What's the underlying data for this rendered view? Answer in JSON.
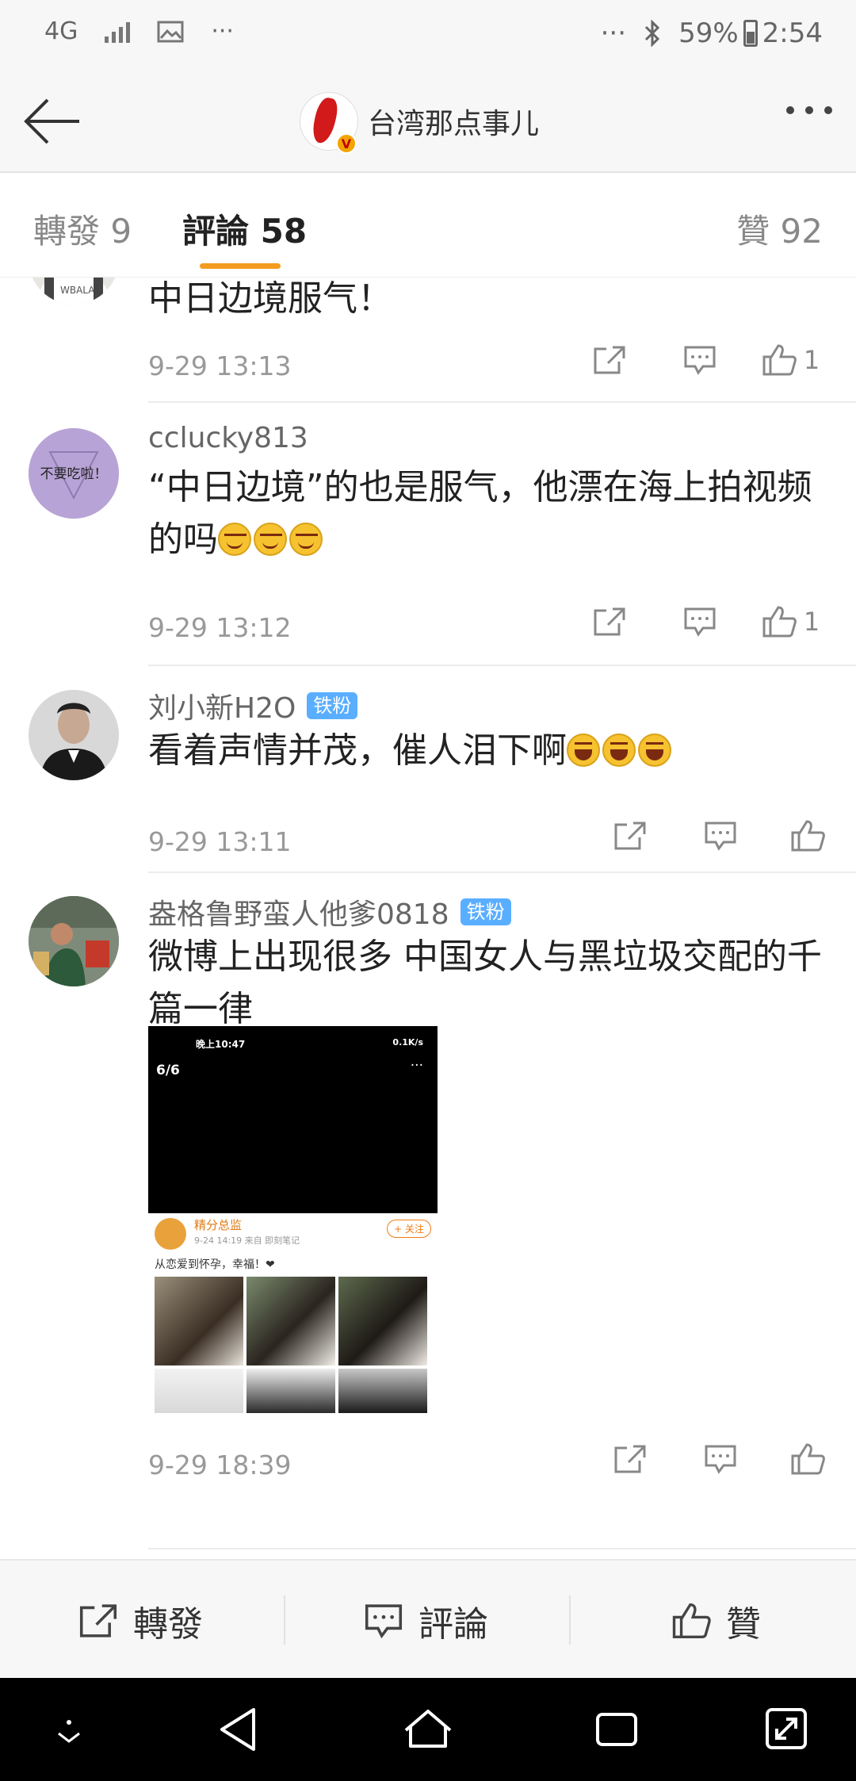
{
  "status_bar": {
    "network": "4G",
    "more_left": "···",
    "more_right": "···",
    "battery": "59%",
    "time": "2:54"
  },
  "nav": {
    "title": "台湾那点事儿",
    "verified_badge": "V"
  },
  "tabs": {
    "repost": "轉發 9",
    "comments": "評論 58",
    "likes": "贊 92"
  },
  "comments": [
    {
      "name": "",
      "text": "中日边境服气！",
      "time": "9-29 13:13",
      "like_count": "1"
    },
    {
      "name": "cclucky813",
      "avatar_text": "不要吃啦！",
      "text": "“中日边境”的也是服气，他漂在海上拍视频的吗",
      "time": "9-29 13:12",
      "like_count": "1"
    },
    {
      "name": "刘小新H2O",
      "badge": "铁粉",
      "text": "看着声情并茂，催人泪下啊",
      "time": "9-29 13:11",
      "like_count": ""
    },
    {
      "name": "盎格鲁野蛮人他爹0818",
      "badge": "铁粉",
      "text": "微博上出现很多 中国女人与黑垃圾交配的千篇一律",
      "time": "9-29 18:39",
      "like_count": "",
      "image": {
        "status_time": "晚上10:47",
        "status_right": "0.1K/s",
        "counter": "6/6",
        "dots": "···",
        "poster_name": "精分总监",
        "poster_meta": "9-24 14:19 来自 即刻笔记",
        "follow": "+ 关注",
        "post_text": "从恋爱到怀孕，幸福！❤"
      }
    }
  ],
  "bottom_bar": {
    "repost": "轉發",
    "comment": "評論",
    "like": "贊"
  },
  "colors": {
    "accent": "#f39c1f",
    "fan_badge": "#5aaeff",
    "text_primary": "#222222",
    "text_secondary": "#999999"
  }
}
